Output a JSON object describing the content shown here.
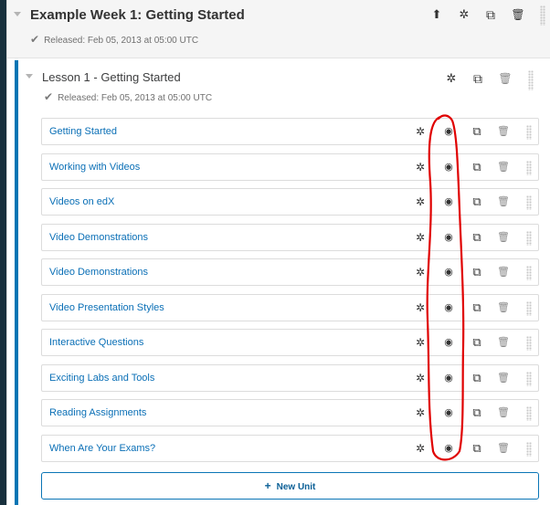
{
  "section": {
    "title": "Example Week 1: Getting Started",
    "released": "Released: Feb 05, 2013 at 05:00 UTC",
    "icons": [
      "upload-icon",
      "gear-icon",
      "copy-icon",
      "trash-icon"
    ]
  },
  "subsection": {
    "title": "Lesson 1 - Getting Started",
    "released": "Released: Feb 05, 2013 at 05:00 UTC"
  },
  "units": [
    {
      "name": "Getting Started"
    },
    {
      "name": "Working with Videos"
    },
    {
      "name": "Videos on edX"
    },
    {
      "name": "Video Demonstrations"
    },
    {
      "name": "Video Demonstrations"
    },
    {
      "name": "Video Presentation Styles"
    },
    {
      "name": "Interactive Questions"
    },
    {
      "name": "Exciting Labs and Tools"
    },
    {
      "name": "Reading Assignments"
    },
    {
      "name": "When Are Your Exams?"
    }
  ],
  "new_unit_label": "New Unit",
  "glyphs": {
    "check": "✔",
    "gear": "✲",
    "eye": "◉",
    "copy": "⧉",
    "trash": "🗑",
    "upload": "⬆",
    "plus": "+"
  },
  "colors": {
    "accent": "#0075b4",
    "link": "#0a6fb6",
    "annotation": "#e00000"
  }
}
